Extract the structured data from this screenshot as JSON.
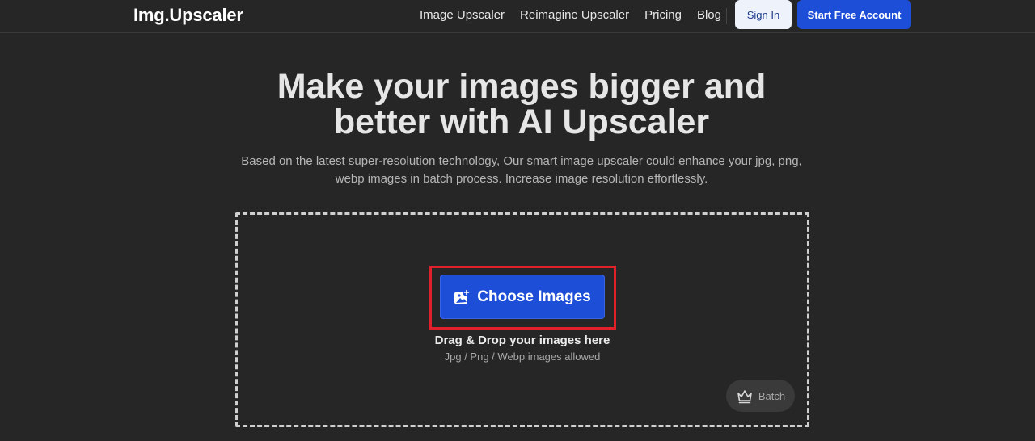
{
  "header": {
    "logo": "Img.Upscaler",
    "nav": [
      {
        "label": "Image Upscaler"
      },
      {
        "label": "Reimagine Upscaler"
      },
      {
        "label": "Pricing"
      },
      {
        "label": "Blog"
      }
    ],
    "sign_in_label": "Sign In",
    "start_label": "Start Free Account"
  },
  "hero": {
    "title_line1": "Make your images bigger and",
    "title_line2": "better with AI Upscaler",
    "subtitle_line1": "Based on the latest super-resolution technology, Our smart image upscaler could enhance your jpg, png,",
    "subtitle_line2": "webp images in batch process. Increase image resolution effortlessly."
  },
  "upload": {
    "choose_label": "Choose Images",
    "drag_text": "Drag & Drop your images here",
    "allowed_text": "Jpg / Png / Webp images allowed",
    "batch_label": "Batch",
    "choose_icon": "image-add-icon",
    "batch_icon": "crown-icon"
  },
  "colors": {
    "background": "#262626",
    "accent": "#1d4ed8",
    "highlight": "#e0202a"
  }
}
